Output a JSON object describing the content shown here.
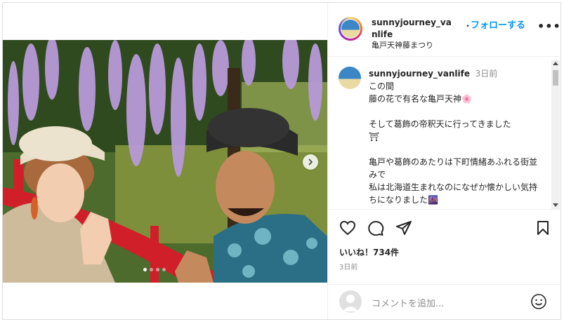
{
  "header": {
    "username": "sunnyjourney_vanlife",
    "separator": "・",
    "follow_label": "フォローする",
    "more_label": "•••",
    "location": "亀戸天神藤まつり"
  },
  "caption": {
    "username": "sunnyjourney_vanlife",
    "time": "3日前",
    "text": "この間\n藤の花で有名な亀戸天神🌸\n\nそして葛飾の帝釈天に行ってきました\n⛩\n\n亀戸や葛飾のあたりは下町情緒あふれる街並みで\n私は北海道生まれなのになぜか懐かしい気持ちになりました🌆"
  },
  "engagement": {
    "likes": "いいね！734件",
    "time_ago": "3日前"
  },
  "comment": {
    "placeholder": "コメントを追加..."
  },
  "icons": {
    "like": "heart-icon",
    "comment": "comment-icon",
    "share": "share-icon",
    "save": "bookmark-icon",
    "emoji": "emoji-icon",
    "next": "chevron-right-icon"
  },
  "colors": {
    "accent": "#0095f6",
    "bridge": "#d11f2a",
    "wisteria": "#b79ad8"
  }
}
